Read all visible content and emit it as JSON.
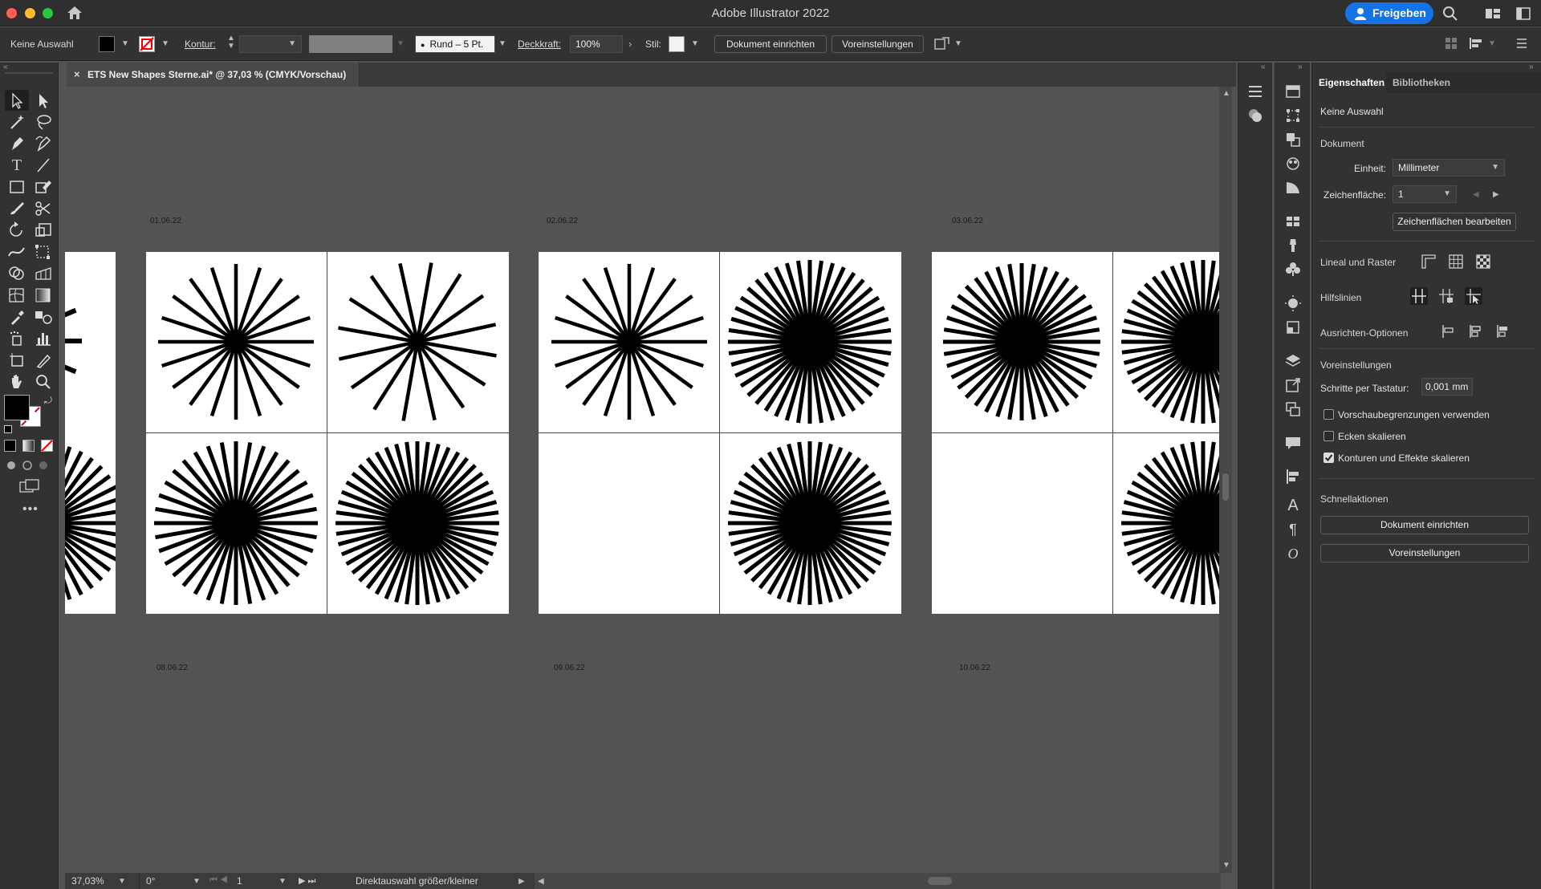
{
  "window": {
    "title": "Adobe Illustrator 2022",
    "share_label": "Freigeben"
  },
  "control_bar": {
    "selection": "Keine Auswahl",
    "kontur_label": "Kontur:",
    "brush_label": "Rund – 5 Pt.",
    "opacity_label": "Deckkraft:",
    "opacity_value": "100%",
    "style_label": "Stil:",
    "document_setup": "Dokument einrichten",
    "preferences": "Voreinstellungen"
  },
  "document_tab": {
    "title": "ETS New Shapes Sterne.ai* @ 37,03 % (CMYK/Vorschau)"
  },
  "canvas": {
    "date_labels_top": [
      "01.06.22",
      "02.06.22",
      "03.06.22"
    ],
    "date_labels_bottom": [
      "08.06.22",
      "09.06.22",
      "10.06.22"
    ]
  },
  "status_bar": {
    "zoom": "37,03%",
    "rotation": "0°",
    "artboard_number": "1",
    "tool_hint": "Direktauswahl größer/kleiner"
  },
  "properties_panel": {
    "tabs": [
      "Eigenschaften",
      "Bibliotheken"
    ],
    "selection_state": "Keine Auswahl",
    "document_section": "Dokument",
    "unit_label": "Einheit:",
    "unit_value": "Millimeter",
    "artboard_label": "Zeichenfläche:",
    "artboard_value": "1",
    "edit_artboards": "Zeichenflächen bearbeiten",
    "rulers_grids": "Lineal und Raster",
    "guides": "Hilfslinien",
    "align_options": "Ausrichten-Optionen",
    "preferences_section": "Voreinstellungen",
    "keyboard_increment_label": "Schritte per Tastatur:",
    "keyboard_increment_value": "0,001 mm",
    "checkboxes": [
      {
        "label": "Vorschaubegrenzungen verwenden",
        "checked": false
      },
      {
        "label": "Ecken skalieren",
        "checked": false
      },
      {
        "label": "Konturen und Effekte skalieren",
        "checked": true
      }
    ],
    "quick_actions": "Schnellaktionen",
    "quick_doc_setup": "Dokument einrichten",
    "quick_prefs": "Voreinstellungen"
  },
  "colors": {
    "accent": "#1473e6",
    "ui_dark": "#323232",
    "canvas": "#535353"
  }
}
